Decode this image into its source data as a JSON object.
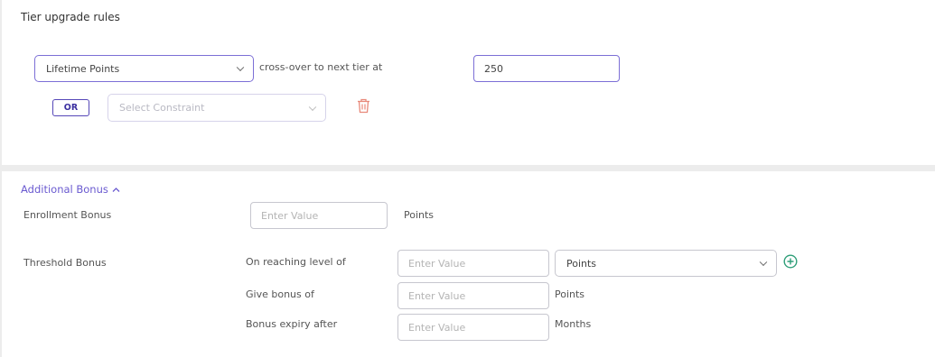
{
  "tier_rules": {
    "title": "Tier upgrade rules",
    "metric_select": "Lifetime Points",
    "crossover_text": "cross-over to next tier at",
    "threshold_value": "250",
    "or_label": "OR",
    "constraint_placeholder": "Select Constraint"
  },
  "bonus": {
    "toggle_label": "Additional Bonus",
    "enrollment": {
      "label": "Enrollment Bonus",
      "placeholder": "Enter Value",
      "unit": "Points"
    },
    "threshold": {
      "label": "Threshold Bonus",
      "reaching_label": "On reaching level of",
      "reaching_placeholder": "Enter Value",
      "unit_select": "Points",
      "give_label": "Give bonus of",
      "give_placeholder": "Enter Value",
      "give_unit": "Points",
      "expiry_label": "Bonus expiry after",
      "expiry_placeholder": "Enter Value",
      "expiry_unit": "Months"
    }
  },
  "colors": {
    "accent": "#7c6fd6",
    "delete_icon": "#e8897a",
    "add_icon": "#2e9e78"
  }
}
